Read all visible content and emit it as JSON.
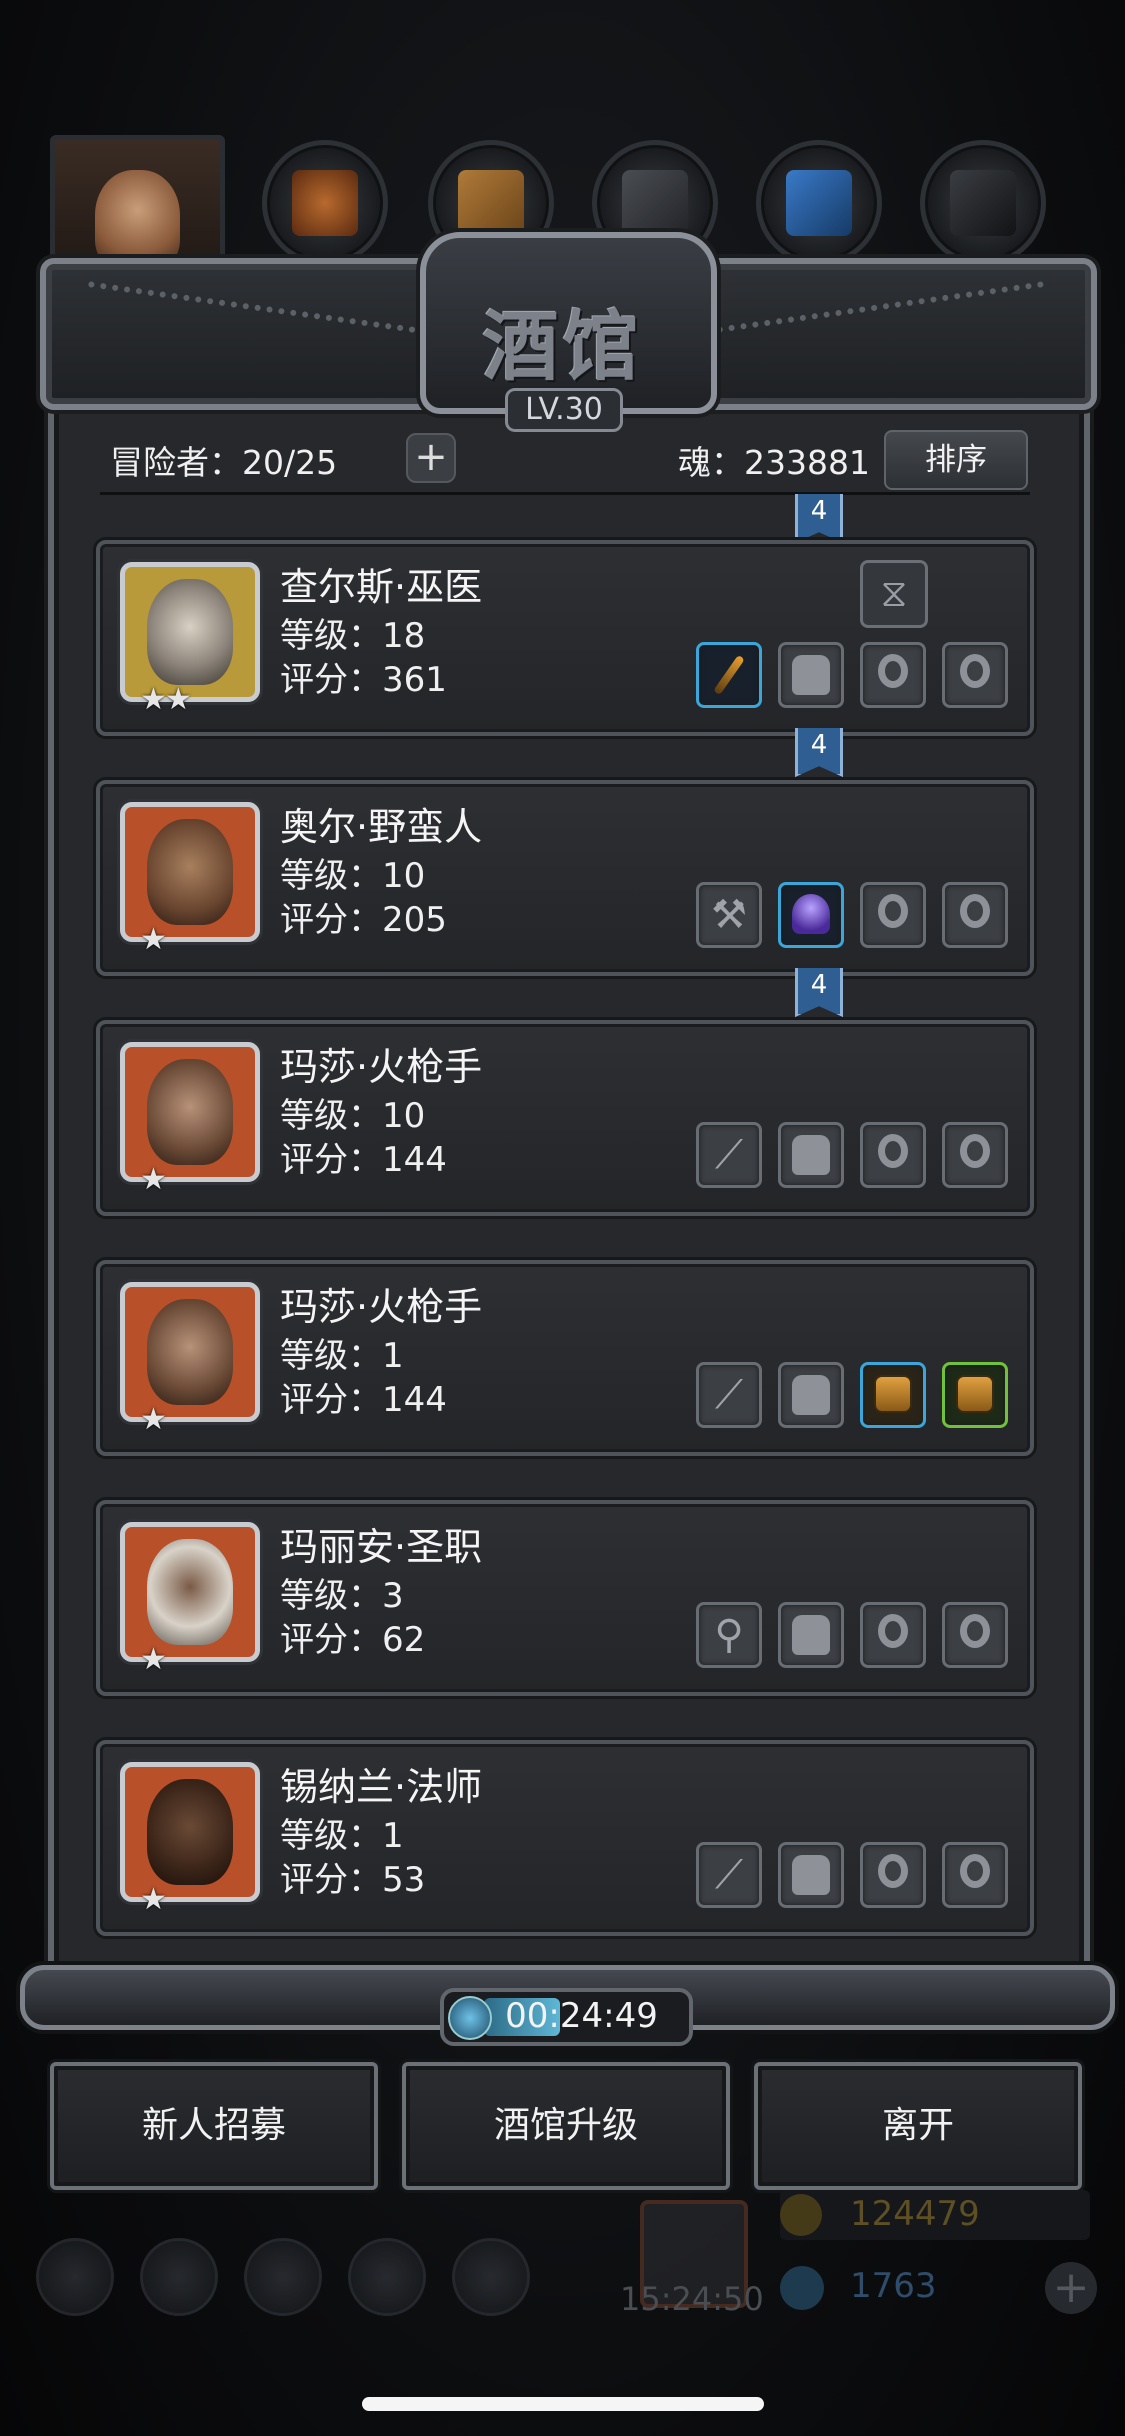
{
  "header": {
    "title": "酒馆",
    "level_badge": "LV.30"
  },
  "info": {
    "adventurers_label": "冒险者：20/25",
    "soul_label": "魂：233881",
    "add_icon": "plus-icon",
    "sort_label": "排序"
  },
  "ribbon_label": "4",
  "adventurers": [
    {
      "name": "查尔斯·巫医",
      "level": "等级：18",
      "score": "评分：361",
      "stars": "★★"
    },
    {
      "name": "奥尔·野蛮人",
      "level": "等级：10",
      "score": "评分：205",
      "stars": "★"
    },
    {
      "name": "玛莎·火枪手",
      "level": "等级：10",
      "score": "评分：144",
      "stars": "★"
    },
    {
      "name": "玛莎·火枪手",
      "level": "等级：1",
      "score": "评分：144",
      "stars": "★"
    },
    {
      "name": "玛丽安·圣职",
      "level": "等级：3",
      "score": "评分：62",
      "stars": "★"
    },
    {
      "name": "锡纳兰·法师",
      "level": "等级：1",
      "score": "评分：53",
      "stars": "★"
    }
  ],
  "timer": {
    "value": "00:24:49"
  },
  "actions": {
    "recruit": "新人招募",
    "upgrade": "酒馆升级",
    "leave": "离开"
  },
  "hud": {
    "gold": "124479",
    "gems": "1763",
    "clock": "15:24:50"
  },
  "colors": {
    "frame": "#60656c",
    "row_bg": "#2d2f33",
    "ribbon": "#2f5e93",
    "avatar_gold": "#b89a3a",
    "avatar_red": "#b8502a"
  }
}
